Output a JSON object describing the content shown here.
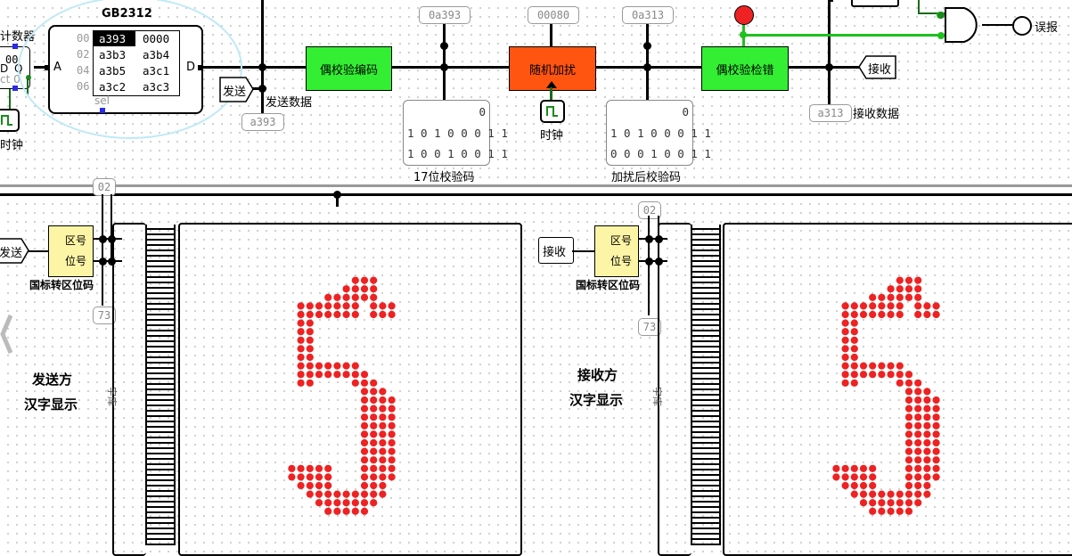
{
  "gb2312": {
    "title": "GB2312",
    "addresses": [
      "00",
      "02",
      "04",
      "06"
    ],
    "rows": [
      [
        "a393",
        "0000"
      ],
      [
        "a3b3",
        "a3b4"
      ],
      [
        "a3b5",
        "a3c1"
      ],
      [
        "a3c2",
        "a3c3"
      ]
    ],
    "pin_a": "A",
    "pin_d": "D",
    "sel": "sel"
  },
  "counter": {
    "label": "计数器",
    "value": "00",
    "d": "D",
    "q": "Q",
    "ct": "ct 0"
  },
  "clock_labels": {
    "left": "时钟",
    "middle": "时钟"
  },
  "blocks": {
    "encoder": "偶校验编码",
    "noise": "随机加扰",
    "checker": "偶校验检错"
  },
  "probes": {
    "send_data_top": "0a393",
    "noise_top": "00080",
    "recv_top": "0a313",
    "send_data_bottom": "a393",
    "recv_data_bottom": "a313",
    "left_bank": "02",
    "left_bank_bottom": "73",
    "right_bank": "02",
    "right_bank_bottom": "73"
  },
  "labels": {
    "send_tag": "发送",
    "send_data": "发送数据",
    "recv_tag": "接收",
    "recv_data": "接收数据",
    "error": "误报",
    "check17": "17位校验码",
    "check_noise": "加扰后校验码"
  },
  "registers": {
    "check17": {
      "top": "0",
      "line1": "1 0 1 0 0 0 1 1",
      "line2": "1 0 0 1 0 0 1 1"
    },
    "check_noise": {
      "top": "0",
      "line1": "1 0 1 0 0 0 1 1",
      "line2": "0 0 0 1 0 0 1 1"
    }
  },
  "sender": {
    "tag": "发送",
    "chip_zone": "区号",
    "chip_pos": "位号",
    "converter": "国标转区位码",
    "caption1": "发送方",
    "caption2": "汉字显示",
    "font_lib": "字库"
  },
  "receiver": {
    "tag": "接收",
    "chip_zone": "区号",
    "chip_pos": "位号",
    "converter": "国标转区位码",
    "caption1": "接收方",
    "caption2": "汉字显示",
    "font_lib": "字库"
  },
  "colors": {
    "encoder": "#33ee33",
    "noise": "#ff5511",
    "checker": "#33ee33",
    "led": "#ee2222",
    "chip": "#fdf5a6"
  },
  "glyph": {
    "rows": [
      "................",
      ".........###....",
      "........####....",
      "......######....",
      "...#######.###..",
      "...#######.###..",
      "...##...........",
      "...##...........",
      "...##...........",
      "...##...........",
      "...##...........",
      "...#######......",
      "...########.....",
      "...##....###....",
      "..........###...",
      "..........####..",
      "..........####..",
      "..........####..",
      "..........####..",
      "..........####..",
      "..........####..",
      "..........####..",
      "..........####..",
      "..#####...####..",
      "..#####...####..",
      "...####...###...",
      "....#########...",
      ".....#######....",
      "......#####....."
    ]
  }
}
